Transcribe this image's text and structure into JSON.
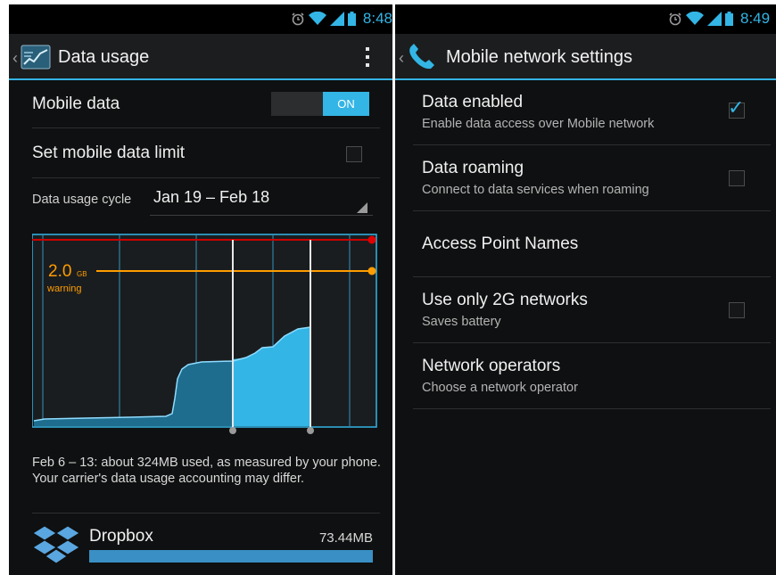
{
  "left": {
    "status": {
      "time": "8:48"
    },
    "action_bar": {
      "title": "Data usage",
      "menu_icon": "overflow-menu-icon",
      "app_icon": "data-usage-settings-icon"
    },
    "mobile_data": {
      "label": "Mobile data",
      "toggle": "ON"
    },
    "limit": {
      "label": "Set mobile data limit",
      "checked": false
    },
    "cycle": {
      "label": "Data usage cycle",
      "value": "Jan 19 – Feb 18"
    },
    "chart": {
      "warning_value": "2.0",
      "warning_unit": "GB",
      "warning_label": "warning",
      "colors": {
        "limit": "#cc0000",
        "warning": "#ff9d00",
        "usage": "#33b5e5",
        "grid": "#2d6e8c"
      }
    },
    "note": "Feb 6 – 13: about 324MB used, as measured by your phone. Your carrier's data usage accounting may differ.",
    "apps": [
      {
        "name": "Dropbox",
        "amount": "73.44MB",
        "share": 1.0,
        "icon": "dropbox-icon"
      }
    ]
  },
  "right": {
    "status": {
      "time": "8:49"
    },
    "action_bar": {
      "title": "Mobile network settings",
      "app_icon": "phone-icon"
    },
    "prefs": [
      {
        "title": "Data enabled",
        "summary": "Enable data access over Mobile network",
        "checkbox": true,
        "checked": true
      },
      {
        "title": "Data roaming",
        "summary": "Connect to data services when roaming",
        "checkbox": true,
        "checked": false
      },
      {
        "title": "Access Point Names",
        "summary": "",
        "checkbox": false,
        "checked": false
      },
      {
        "title": "Use only 2G networks",
        "summary": "Saves battery",
        "checkbox": true,
        "checked": false
      },
      {
        "title": "Network operators",
        "summary": "Choose a network operator",
        "checkbox": false,
        "checked": false
      }
    ]
  },
  "accent": "#33b5e5"
}
